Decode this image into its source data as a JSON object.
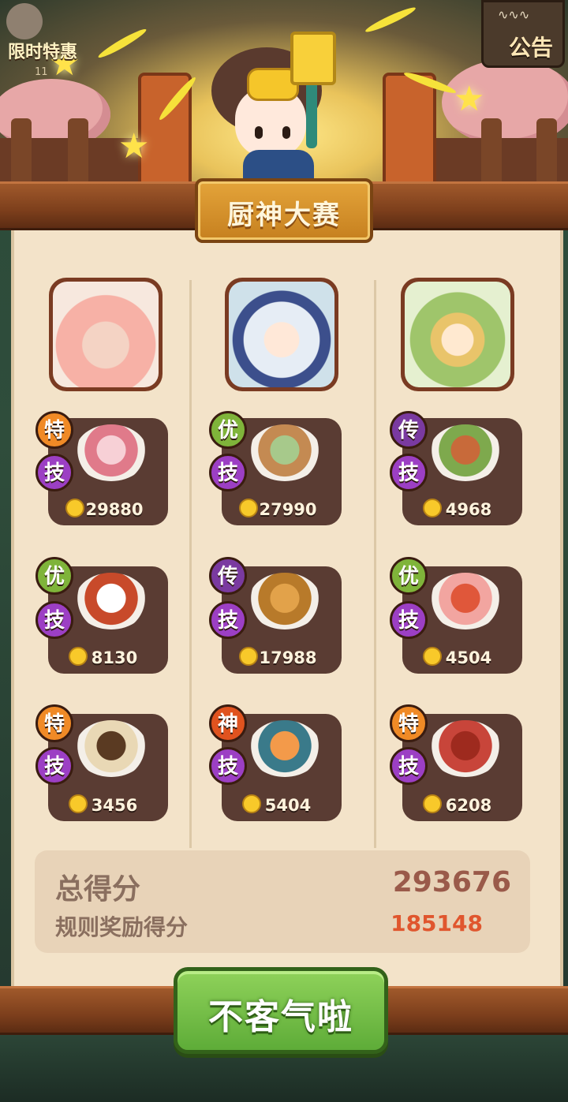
{
  "top_left": {
    "label": "限时特惠",
    "timer": "11"
  },
  "notice": {
    "label": "公告"
  },
  "title": "厨神大赛",
  "chefs": [
    {
      "name": "chef-rabbit-hood"
    },
    {
      "name": "chef-moon-headband"
    },
    {
      "name": "chef-golden-crown"
    }
  ],
  "dishes": [
    {
      "tier": "特",
      "skill": "技",
      "price": "29880",
      "tier_color": "orange"
    },
    {
      "tier": "优",
      "skill": "技",
      "price": "27990",
      "tier_color": "green"
    },
    {
      "tier": "传",
      "skill": "技",
      "price": "4968",
      "tier_color": "purple"
    },
    {
      "tier": "优",
      "skill": "技",
      "price": "8130",
      "tier_color": "green"
    },
    {
      "tier": "传",
      "skill": "技",
      "price": "17988",
      "tier_color": "purple"
    },
    {
      "tier": "优",
      "skill": "技",
      "price": "4504",
      "tier_color": "green"
    },
    {
      "tier": "特",
      "skill": "技",
      "price": "3456",
      "tier_color": "orange"
    },
    {
      "tier": "神",
      "skill": "技",
      "price": "5404",
      "tier_color": "red"
    },
    {
      "tier": "特",
      "skill": "技",
      "price": "6208",
      "tier_color": "orange"
    }
  ],
  "score": {
    "total_label": "总得分",
    "total_value": "293676",
    "bonus_label": "规则奖励得分",
    "bonus_value": "185148"
  },
  "confirm_button": "不客气啦",
  "colors": {
    "accent_green": "#6cba42",
    "title_gold": "#d99530",
    "bonus_red": "#e0562e"
  }
}
